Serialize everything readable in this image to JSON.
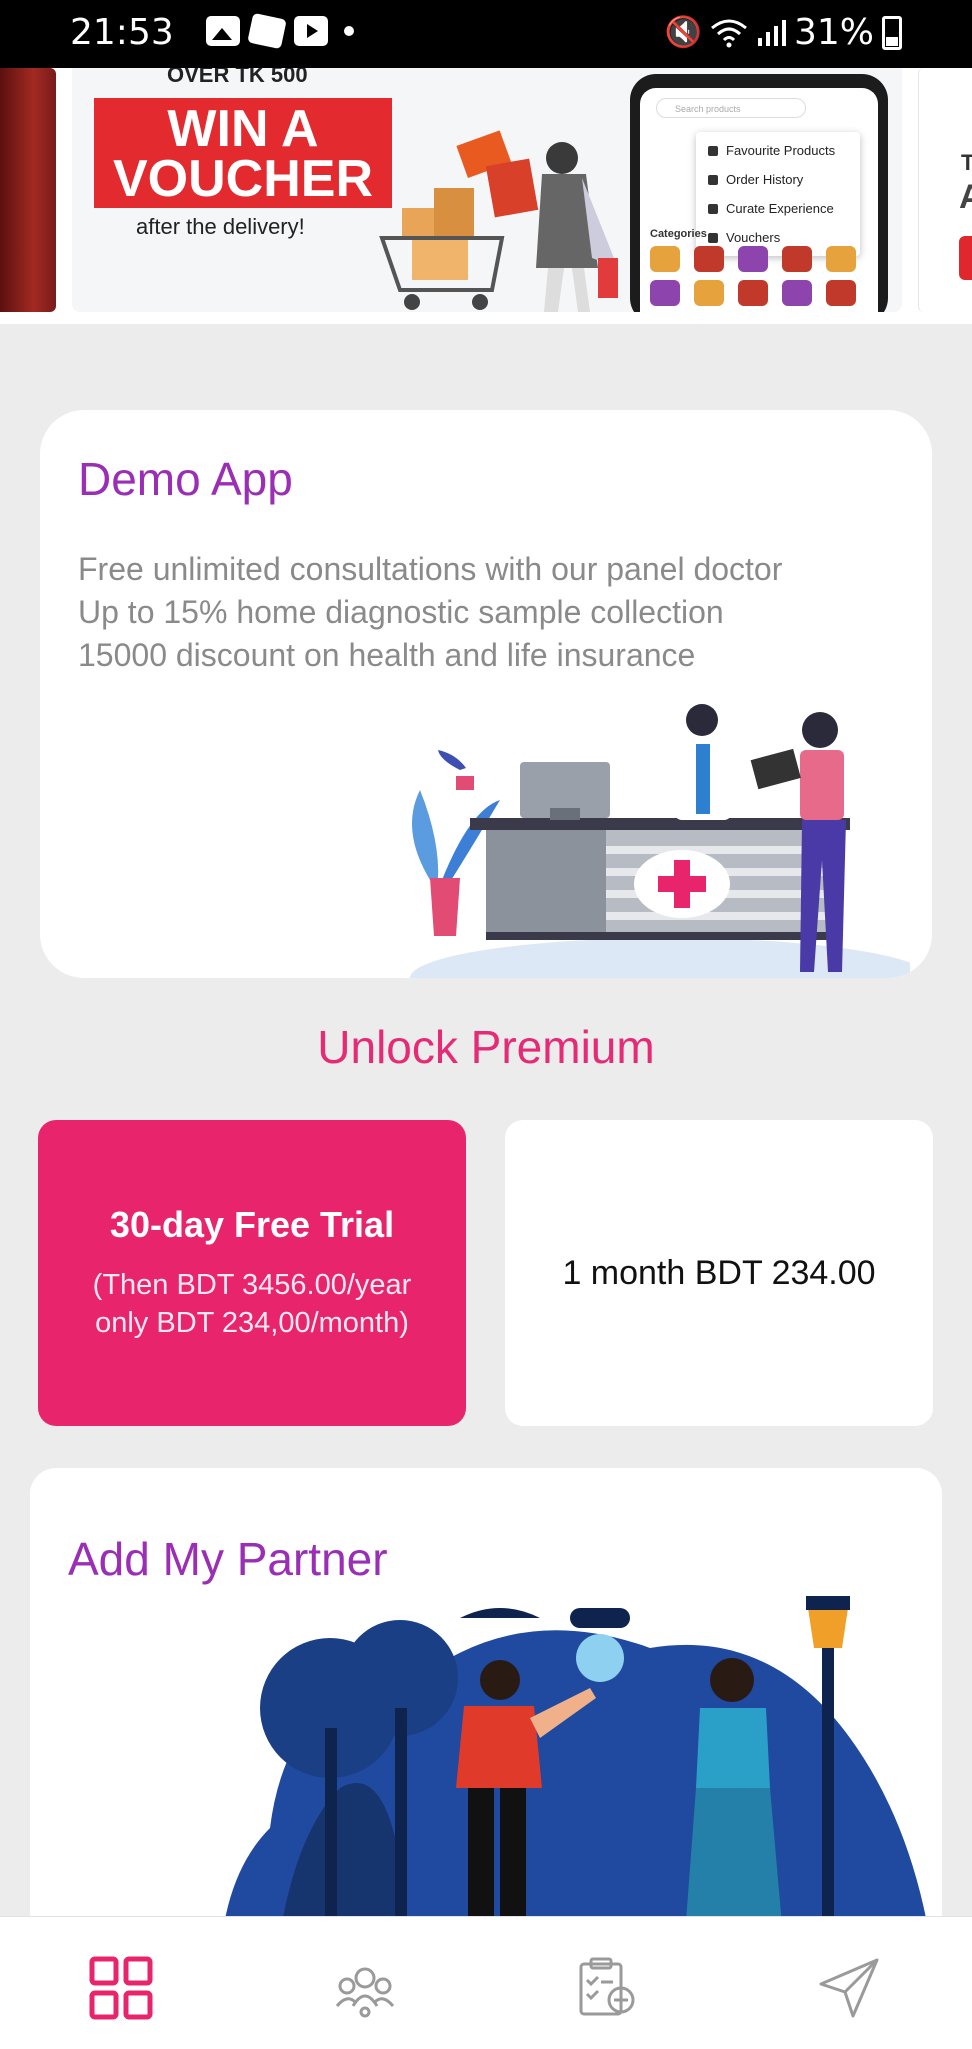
{
  "status_bar": {
    "time": "21:53",
    "battery": "31%"
  },
  "banner": {
    "over_text": "OVER TK 500",
    "headline_line1": "WIN A",
    "headline_line2": "VOUCHER",
    "subline": "after the delivery!",
    "phone_search_placeholder": "Search products",
    "phone_menu": [
      "Favourite Products",
      "Order History",
      "Curate Experience",
      "Vouchers"
    ],
    "phone_categories_label": "Categories",
    "right_peek_text1": "T",
    "right_peek_text2": "A"
  },
  "demo_card": {
    "title": "Demo App",
    "lines": [
      "Free unlimited consultations with our panel doctor",
      "Up to 15% home diagnostic sample collection",
      "15000 discount on health and life insurance"
    ]
  },
  "premium": {
    "heading": "Unlock Premium",
    "trial_title": "30-day Free Trial",
    "trial_sub_line1": "(Then BDT 3456.00/year",
    "trial_sub_line2": "only BDT 234,00/month)",
    "month_label": "1 month BDT 234.00"
  },
  "partner_card": {
    "title": "Add My Partner"
  },
  "bottom_nav": [
    {
      "icon": "grid-icon",
      "active": true
    },
    {
      "icon": "people-network-icon",
      "active": false
    },
    {
      "icon": "clipboard-add-icon",
      "active": false
    },
    {
      "icon": "send-icon",
      "active": false
    }
  ],
  "colors": {
    "accent_pink": "#e8246c",
    "title_purple": "#9a2fb5",
    "heading_pink": "#e52a76",
    "background": "#ececec"
  }
}
